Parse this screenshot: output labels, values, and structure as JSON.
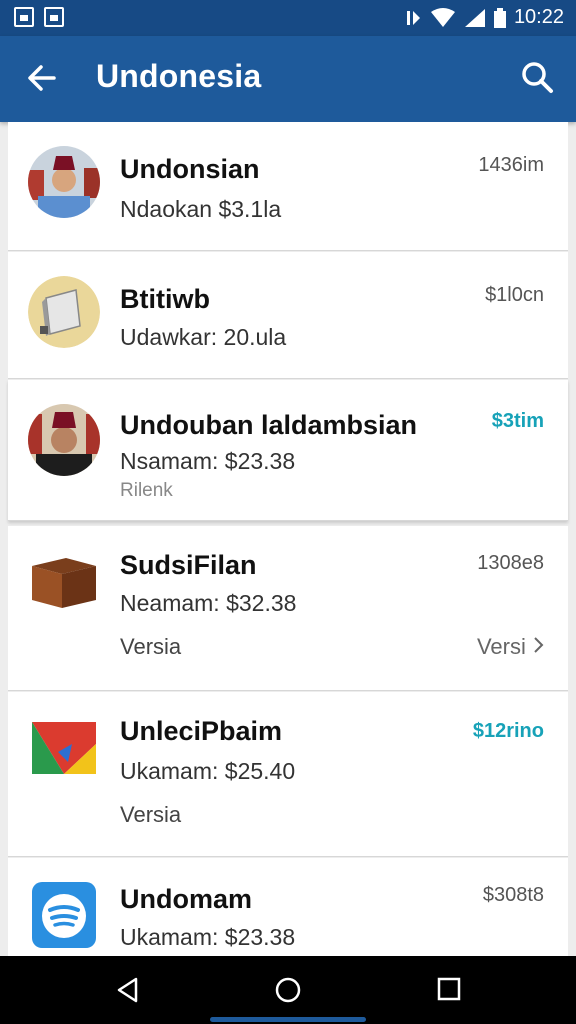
{
  "status_bar": {
    "time": "10:22"
  },
  "app_bar": {
    "title": "Undonesia"
  },
  "items": [
    {
      "name": "Undonsian",
      "detail": "Ndaokan $3.1la",
      "price": "1436im"
    },
    {
      "name": "Btitiwb",
      "detail": "Udawkar: 20.ula",
      "price": "$1l0cn"
    },
    {
      "name": "Undouban laldambsian",
      "detail": "Nsamam: $23.38",
      "note": "Rilenk",
      "price": "$3tim"
    },
    {
      "name": "SudsiFilan",
      "detail": "Neamam: $32.38",
      "version": "Versia",
      "version_right": "Versi",
      "price": "1308e8"
    },
    {
      "name": "UnleciPbaim",
      "detail": "Ukamam: $25.40",
      "version": "Versia",
      "price": "$12rino"
    },
    {
      "name": "Undomam",
      "detail": "Ukamam: $23.38",
      "price": "$308t8"
    }
  ],
  "colors": {
    "app_bar": "#1e5a9b",
    "status_bar": "#174a85",
    "accent_price": "#17a2b8"
  }
}
